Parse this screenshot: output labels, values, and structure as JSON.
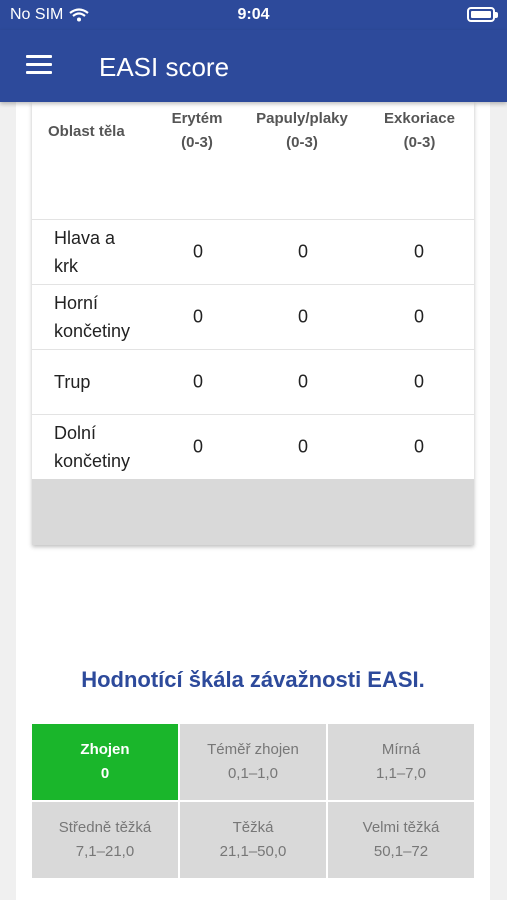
{
  "status_bar": {
    "carrier": "No SIM",
    "time": "9:04"
  },
  "app_bar": {
    "title": "EASI score"
  },
  "table": {
    "headers": {
      "area": "Oblast těla",
      "erythema": [
        "Erytém",
        "(0-3)"
      ],
      "papules": [
        "Papuly/plaky",
        "(0-3)"
      ],
      "excoriation": [
        "Exkoriace",
        "(0-3)"
      ]
    },
    "rows": [
      {
        "area": [
          "Hlava a",
          "krk"
        ],
        "values": [
          "0",
          "0",
          "0"
        ]
      },
      {
        "area": [
          "Horní",
          "končetiny"
        ],
        "values": [
          "0",
          "0",
          "0"
        ]
      },
      {
        "area": [
          "Trup"
        ],
        "values": [
          "0",
          "0",
          "0"
        ]
      },
      {
        "area": [
          "Dolní",
          "končetiny"
        ],
        "values": [
          "0",
          "0",
          "0"
        ]
      }
    ]
  },
  "scale": {
    "title": "Hodnotící škála závažnosti EASI.",
    "active_color": "#1ab62b",
    "items": [
      {
        "label": "Zhojen",
        "range": "0",
        "active": true
      },
      {
        "label": "Téměř zhojen",
        "range": "0,1–1,0",
        "active": false
      },
      {
        "label": "Mírná",
        "range": "1,1–7,0",
        "active": false
      },
      {
        "label": "Středně těžká",
        "range": "7,1–21,0",
        "active": false
      },
      {
        "label": "Těžká",
        "range": "21,1–50,0",
        "active": false
      },
      {
        "label": "Velmi těžká",
        "range": "50,1–72",
        "active": false
      }
    ]
  }
}
